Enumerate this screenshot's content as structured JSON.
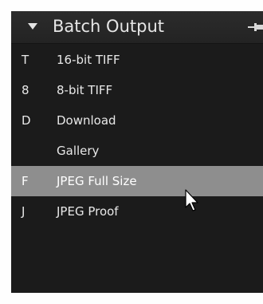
{
  "panel": {
    "title": "Batch Output",
    "icons": {
      "collapse": "triangle-down-icon",
      "pin": "pin-icon"
    },
    "items": [
      {
        "key": "T",
        "label": "16-bit TIFF",
        "selected": false
      },
      {
        "key": "8",
        "label": "8-bit TIFF",
        "selected": false
      },
      {
        "key": "D",
        "label": "Download",
        "selected": false
      },
      {
        "key": "",
        "label": "Gallery",
        "selected": false
      },
      {
        "key": "F",
        "label": "JPEG Full Size",
        "selected": true
      },
      {
        "key": "J",
        "label": "JPEG Proof",
        "selected": false
      }
    ]
  },
  "colors": {
    "panel_bg": "#1b1b1b",
    "selected_bg": "#8e8e8e",
    "text": "#e8e8e8"
  }
}
